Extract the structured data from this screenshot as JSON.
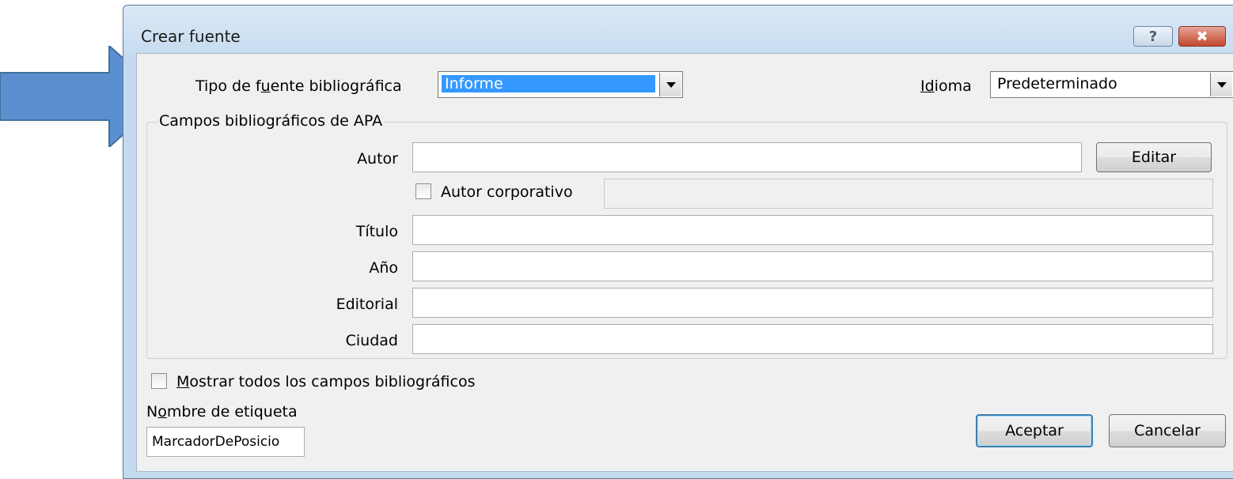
{
  "window": {
    "title": "Crear fuente",
    "help_glyph": "?",
    "close_glyph": "✖"
  },
  "source_type": {
    "label_pre": "Tipo de f",
    "label_accel": "u",
    "label_post": "ente bibliográfica",
    "value": "Informe"
  },
  "language": {
    "label_pre": "",
    "label_first": "I",
    "label_accel": "d",
    "label_post": "ioma",
    "value": "Predeterminado"
  },
  "group": {
    "title": "Campos bibliográficos de APA",
    "author_label": "Autor",
    "author_value": "",
    "edit_button": "Editar",
    "corporate_author_label": "Autor corporativo",
    "corporate_author_checked": false,
    "corporate_author_value": "",
    "title_label": "Título",
    "title_value": "",
    "year_label": "Año",
    "year_value": "",
    "publisher_label": "Editorial",
    "publisher_value": "",
    "city_label": "Ciudad",
    "city_value": ""
  },
  "show_all": {
    "label_accel": "M",
    "label_post": "ostrar todos los campos bibliográficos",
    "checked": false
  },
  "tag_name": {
    "label_pre": "N",
    "label_accel": "o",
    "label_post": "mbre de etiqueta",
    "value": "MarcadorDePosicio"
  },
  "buttons": {
    "ok": "Aceptar",
    "cancel": "Cancelar"
  },
  "colors": {
    "arrow": "#5b8fd0",
    "selection": "#3399ff",
    "window_frame": "#c4dbef"
  }
}
